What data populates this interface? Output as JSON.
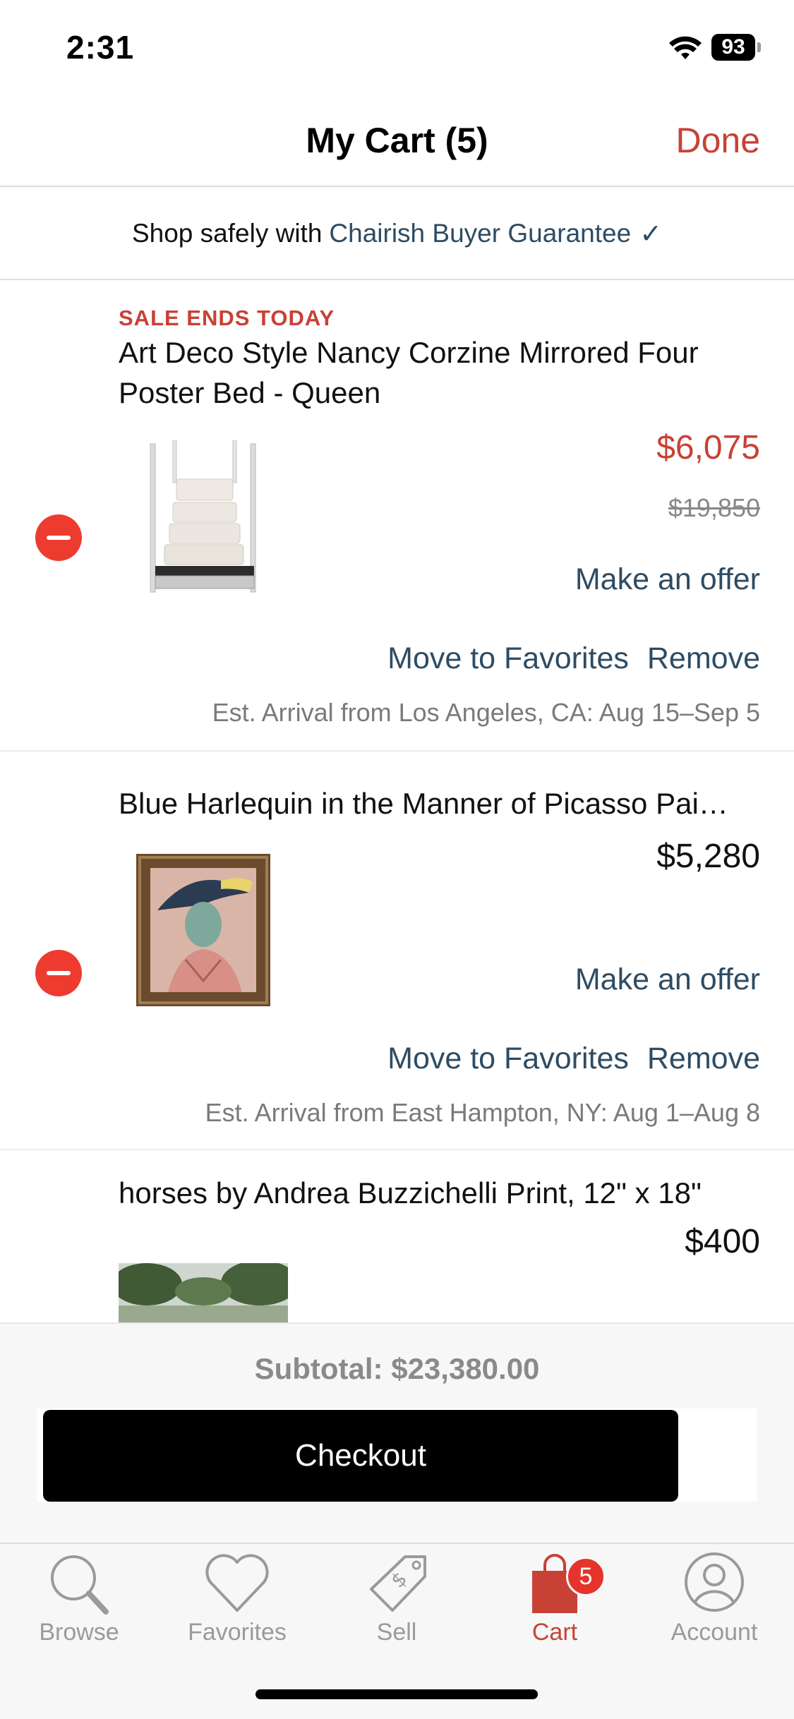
{
  "status_bar": {
    "time": "2:31",
    "battery": "93"
  },
  "nav": {
    "title": "My Cart (5)",
    "done_label": "Done"
  },
  "guarantee": {
    "prefix": "Shop safely with",
    "link": "Chairish Buyer Guarantee",
    "check": "✓"
  },
  "items": [
    {
      "badge": "SALE ENDS TODAY",
      "title": "Art Deco Style Nancy Corzine Mirrored Four Poster Bed - Queen",
      "price": "$6,075",
      "original_price": "$19,850",
      "offer_label": "Make an offer",
      "favorites_label": "Move to Favorites",
      "remove_label": "Remove",
      "arrival": "Est. Arrival from Los Angeles, CA: Aug 15–Sep 5"
    },
    {
      "title": "Blue Harlequin in the Manner of Picasso Pai…",
      "price": "$5,280",
      "offer_label": "Make an offer",
      "favorites_label": "Move to Favorites",
      "remove_label": "Remove",
      "arrival": "Est. Arrival from East Hampton, NY: Aug 1–Aug 8"
    },
    {
      "title": "horses by Andrea Buzzichelli Print, 12\" x 18\"",
      "price": "$400"
    }
  ],
  "summary": {
    "subtotal": "Subtotal: $23,380.00",
    "checkout_label": "Checkout"
  },
  "tabs": [
    {
      "label": "Browse",
      "icon": "search-icon"
    },
    {
      "label": "Favorites",
      "icon": "heart-icon"
    },
    {
      "label": "Sell",
      "icon": "price-tag-icon"
    },
    {
      "label": "Cart",
      "icon": "shopping-bag-icon",
      "badge": "5"
    },
    {
      "label": "Account",
      "icon": "person-icon"
    }
  ],
  "colors": {
    "accent": "#c94135",
    "link": "#2e4c63",
    "remove": "#ee3b30"
  }
}
